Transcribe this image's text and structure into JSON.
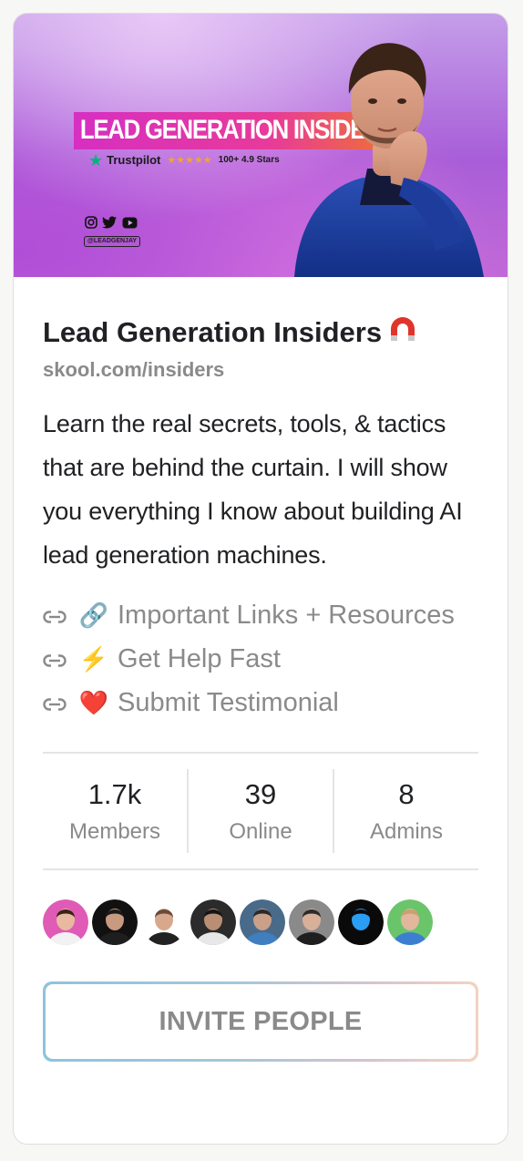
{
  "banner": {
    "title": "LEAD GENERATION INSIDERS",
    "trustpilot": "Trustpilot",
    "stars": "★★★★★",
    "rating_text": "100+ 4.9 Stars",
    "handle": "@LEADGENJAY",
    "social_icons": [
      "instagram-icon",
      "twitter-icon",
      "youtube-icon"
    ]
  },
  "group": {
    "name": "Lead Generation Insiders",
    "name_icon": "magnet-icon",
    "url": "skool.com/insiders",
    "description": "Learn the real secrets, tools, & tactics that are behind the curtain. I will show you everything I know about building AI lead generation machines."
  },
  "links": [
    {
      "emoji": "🔗",
      "label": "Important Links + Resources"
    },
    {
      "emoji": "⚡",
      "label": "Get Help Fast"
    },
    {
      "emoji": "❤️",
      "label": "Submit Testimonial"
    }
  ],
  "stats": [
    {
      "value": "1.7k",
      "label": "Members"
    },
    {
      "value": "39",
      "label": "Online"
    },
    {
      "value": "8",
      "label": "Admins"
    }
  ],
  "avatars": [
    {
      "bg": "#e05bb5",
      "skin": "#e8b9a0",
      "hair": "#3a2418",
      "shirt": "#f2f2f2"
    },
    {
      "bg": "#111111",
      "skin": "#c89a80",
      "hair": "#1a1a1a",
      "shirt": "#1e1e1e"
    },
    {
      "bg": "#ffffff",
      "skin": "#d8a88c",
      "hair": "#6b4a3a",
      "shirt": "#222222"
    },
    {
      "bg": "#2b2b2b",
      "skin": "#b98e74",
      "hair": "#151515",
      "shirt": "#e8e8e8"
    },
    {
      "bg": "#4a6a8a",
      "skin": "#caa088",
      "hair": "#2a2a2a",
      "shirt": "#3f7fbf"
    },
    {
      "bg": "#8a8a8a",
      "skin": "#d8b09a",
      "hair": "#2b2b2b",
      "shirt": "#1f1f1f"
    },
    {
      "bg": "#0a0a0a",
      "skin": "#2a9df4",
      "hair": "#0a0a0a",
      "shirt": "#0a0a0a"
    },
    {
      "bg": "#6ac56a",
      "skin": "#e2b79e",
      "hair": "#c9a070",
      "shirt": "#3c7fd0"
    }
  ],
  "invite_label": "INVITE PEOPLE",
  "colors": {
    "text_primary": "#202124",
    "text_muted": "#8a8a8a",
    "divider": "#e4e4e4"
  }
}
